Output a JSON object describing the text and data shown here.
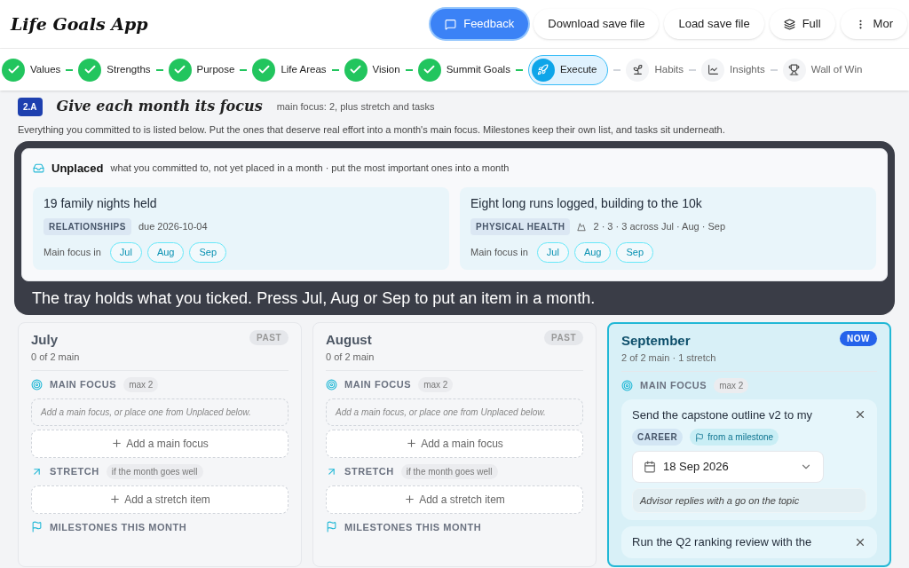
{
  "app": {
    "title": "Life Goals App"
  },
  "header_buttons": [
    {
      "label": "Feedback",
      "kind": "primary"
    },
    {
      "label": "Download save file",
      "kind": "plain"
    },
    {
      "label": "Load save file",
      "kind": "plain"
    },
    {
      "label": "Full",
      "kind": "layers"
    },
    {
      "label": "Mor",
      "kind": "more"
    }
  ],
  "steps": [
    {
      "label": "Values",
      "kind": "done"
    },
    {
      "label": "Strengths",
      "kind": "done"
    },
    {
      "label": "Purpose",
      "kind": "done"
    },
    {
      "label": "Life Areas",
      "kind": "done"
    },
    {
      "label": "Vision",
      "kind": "done"
    },
    {
      "label": "Summit Goals",
      "kind": "done"
    },
    {
      "label": "Execute",
      "kind": "current"
    },
    {
      "label": "Habits",
      "kind": "habits"
    },
    {
      "label": "Insights",
      "kind": "insights"
    },
    {
      "label": "Wall of Win",
      "kind": "wall"
    }
  ],
  "section": {
    "badge": "2.A",
    "title": "Give each month its focus",
    "note": "main focus: 2, plus stretch and tasks",
    "intro": "Everything you committed to is listed below. Put the ones that deserve real effort into a month's main focus. Milestones keep their own list, and tasks sit underneath."
  },
  "tray": {
    "title": "Unplaced",
    "subtitle": "what you committed to, not yet placed in a month · put the most important ones into a month",
    "items": [
      {
        "title": "19 family nights held",
        "area": "RELATIONSHIPS",
        "kind": "due",
        "meta": "due 2026-10-04",
        "focus_label": "Main focus in",
        "months": [
          "Jul",
          "Aug",
          "Sep"
        ]
      },
      {
        "title": "Eight long runs logged, building to the 10k",
        "area": "PHYSICAL HEALTH",
        "kind": "split",
        "meta": "2 · 3 · 3 across Jul · Aug · Sep",
        "focus_label": "Main focus in",
        "months": [
          "Jul",
          "Aug",
          "Sep"
        ]
      }
    ]
  },
  "tip": "The tray holds what you ticked. Press Jul, Aug or Sep to put an item in a month.",
  "months": [
    {
      "name": "July",
      "badge": "PAST",
      "current": false,
      "summary": "0 of 2 main",
      "main_label": "MAIN FOCUS",
      "main_max": "max 2",
      "empty_hint": "Add a main focus, or place one from Unplaced below.",
      "add_main": "Add a main focus",
      "stretch_label": "STRETCH",
      "stretch_note": "if the month goes well",
      "add_stretch": "Add a stretch item",
      "milestones_label": "MILESTONES THIS MONTH"
    },
    {
      "name": "August",
      "badge": "PAST",
      "current": false,
      "summary": "0 of 2 main",
      "main_label": "MAIN FOCUS",
      "main_max": "max 2",
      "empty_hint": "Add a main focus, or place one from Unplaced below.",
      "add_main": "Add a main focus",
      "stretch_label": "STRETCH",
      "stretch_note": "if the month goes well",
      "add_stretch": "Add a stretch item",
      "milestones_label": "MILESTONES THIS MONTH"
    },
    {
      "name": "September",
      "badge": "NOW",
      "current": true,
      "summary": "2 of 2 main · 1 stretch",
      "main_label": "MAIN FOCUS",
      "main_max": "max 2",
      "main_items": [
        {
          "title": "Send the capstone outline v2 to my",
          "area": "CAREER",
          "origin": "from a milestone",
          "date": "18 Sep 2026",
          "note": "Advisor replies with a go on the topic"
        },
        {
          "title": "Run the Q2 ranking review with the"
        }
      ]
    }
  ]
}
